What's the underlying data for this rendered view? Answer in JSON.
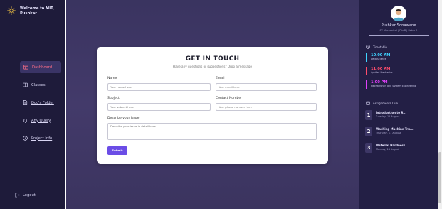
{
  "sidebar": {
    "welcome_line1": "Welcome to MIT,",
    "welcome_line2": "Pushkar",
    "items": [
      {
        "label": "Dashboard",
        "icon": "dashboard-icon"
      },
      {
        "label": "Classes",
        "icon": "classes-icon"
      },
      {
        "label": "Doc's Folder",
        "icon": "document-icon"
      },
      {
        "label": "Any Query",
        "icon": "bell-icon"
      },
      {
        "label": "Project Info",
        "icon": "info-icon"
      }
    ],
    "logout_label": "Logout"
  },
  "form": {
    "title": "GET IN TOUCH",
    "subtitle": "Have any questions or suggestions? Drop a message",
    "name_label": "Name",
    "name_placeholder": "Your name here",
    "email_label": "Email",
    "email_placeholder": "Your email here",
    "subject_label": "Subject",
    "subject_placeholder": "Your subject here",
    "contact_label": "Contact Number",
    "contact_placeholder": "Your phone number here",
    "issue_label": "Describe your Issue",
    "issue_placeholder": "Describe your issue in detail here",
    "submit_label": "Submit"
  },
  "profile": {
    "name": "Pushkar Sonawane",
    "subtitle": "SY Mechanical | Div B | Batch 2"
  },
  "timetable": {
    "heading": "Timetable",
    "entries": [
      {
        "time": "10.00 AM",
        "subject": "Data Science",
        "color": "#3fd3ff"
      },
      {
        "time": "11.00 AM",
        "subject": "Applied Mechanics",
        "color": "#ff4d6d"
      },
      {
        "time": "1.00 PM",
        "subject": "Mechatronics and System Engineering",
        "color": "#e040fb"
      }
    ]
  },
  "assignments": {
    "heading": "Assignments Due",
    "items": [
      {
        "num": "1",
        "title": "Introduction to R...",
        "date": "Tuesday, 15 August"
      },
      {
        "num": "2",
        "title": "Washing Machine Tru...",
        "date": "Thursday, 17 August"
      },
      {
        "num": "3",
        "title": "Material Hardness...",
        "date": "Monday, 14 August"
      }
    ]
  },
  "colors": {
    "accent": "#6b4de6",
    "active_nav": "#ff6f88",
    "sidebar_bg": "#1e1b3a"
  }
}
